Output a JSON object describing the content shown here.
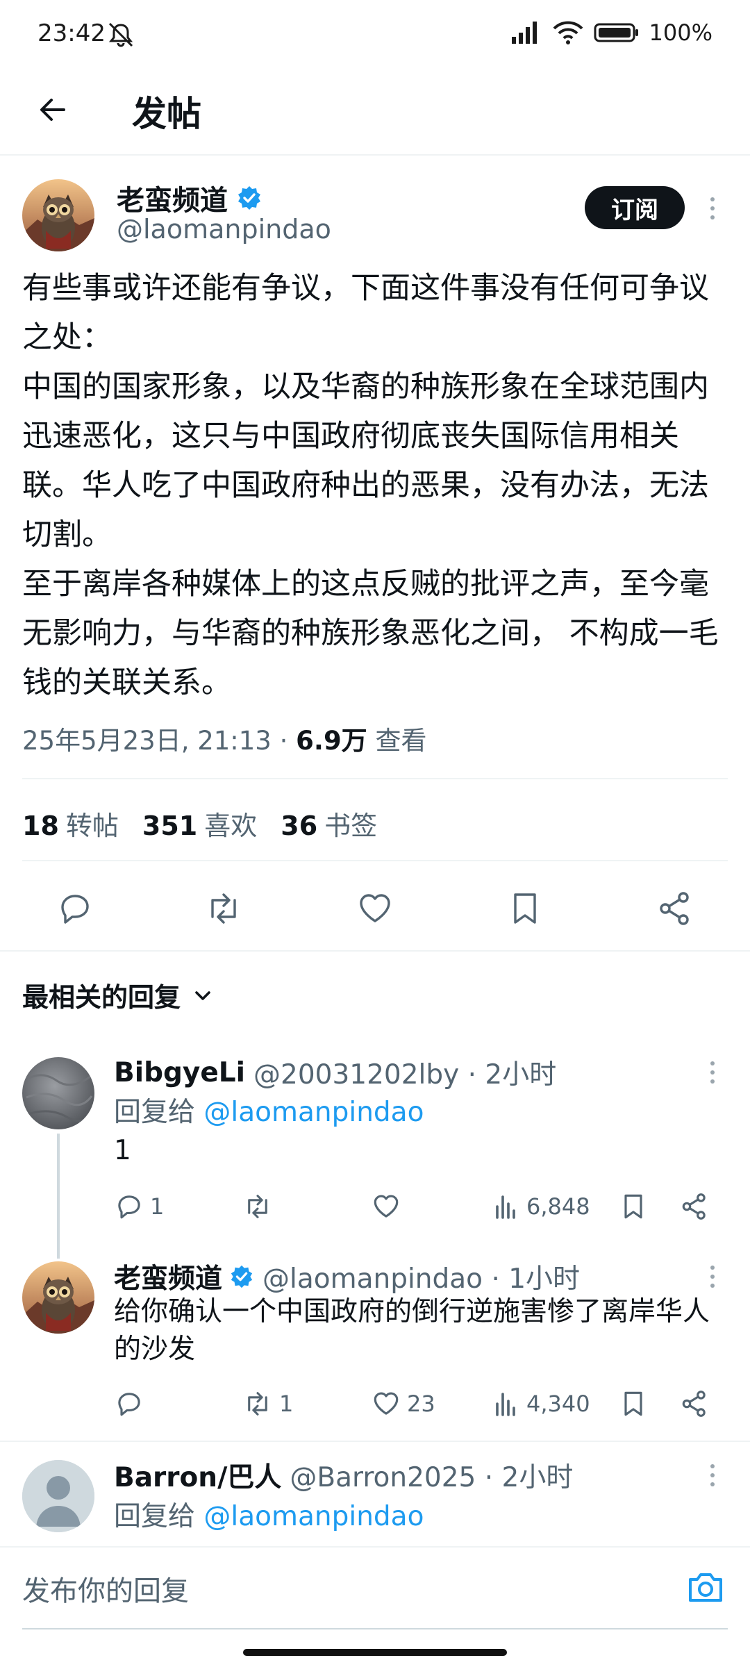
{
  "status_bar": {
    "time": "23:42",
    "battery": "100%"
  },
  "header": {
    "title": "发帖"
  },
  "post": {
    "author_name": "老蛮频道",
    "author_handle": "@laomanpindao",
    "subscribe_label": "订阅",
    "text": "有些事或许还能有争议，下面这件事没有任何可争议之处：\n中国的国家形象，以及华裔的种族形象在全球范围内迅速恶化，这只与中国政府彻底丧失国际信用相关联。华人吃了中国政府种出的恶果，没有办法，无法切割。\n至于离岸各种媒体上的这点反贼的批评之声，至今毫无影响力，与华裔的种族形象恶化之间， 不构成一毛钱的关联关系。",
    "date": "25年5月23日, 21:13 · ",
    "views": "6.9万",
    "views_label": " 查看",
    "stats": {
      "reposts": "18",
      "reposts_label": "转帖",
      "likes": "351",
      "likes_label": "喜欢",
      "bookmarks": "36",
      "bookmarks_label": "书签"
    }
  },
  "sort_label": "最相关的回复",
  "replies": [
    {
      "name": "BibgyeLi",
      "handle": "@20031202lby · 2小时",
      "reply_to_label": "回复给 ",
      "reply_to_handle": "@laomanpindao",
      "text": "1",
      "replies": "1",
      "reposts": "",
      "likes": "",
      "views": "6,848"
    },
    {
      "name": "老蛮频道",
      "handle": "@laomanpindao · 1小时",
      "text": "给你确认一个中国政府的倒行逆施害惨了离岸华人的沙发",
      "replies": "",
      "reposts": "1",
      "likes": "23",
      "views": "4,340"
    },
    {
      "name": "Barron/巴人",
      "handle": "@Barron2025 · 2小时",
      "reply_to_label": "回复给 ",
      "reply_to_handle": "@laomanpindao"
    }
  ],
  "composer": {
    "placeholder": "发布你的回复"
  },
  "colors": {
    "accent": "#1d9bf0",
    "text": "#0f1419",
    "muted": "#536471",
    "divider": "#eff3f4"
  },
  "icons": [
    "back-arrow-icon",
    "verified-badge-icon",
    "reply-icon",
    "repost-icon",
    "like-icon",
    "bookmark-icon",
    "share-icon",
    "views-icon",
    "chevron-down-icon",
    "camera-icon",
    "more-icon"
  ]
}
